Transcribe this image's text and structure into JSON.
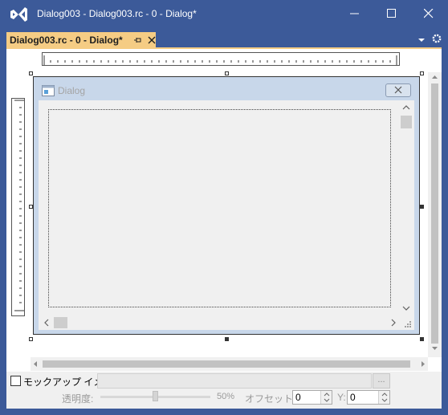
{
  "window": {
    "title": "Dialog003 - Dialog003.rc - 0 - Dialog*",
    "minimize_label": "minimize",
    "maximize_label": "maximize",
    "close_label": "close"
  },
  "tab": {
    "label": "Dialog003.rc - 0 - Dialog*"
  },
  "dialog": {
    "title": "Dialog"
  },
  "bottom": {
    "mockup_label": "モックアップ イメージ",
    "mockup_checked": false,
    "image_path": "",
    "browse_label": "...",
    "opacity_label": "透明度:",
    "opacity_value": 50,
    "opacity_text": "50%",
    "offset_x_label": "オフセット X:",
    "offset_x_value": "0",
    "offset_y_label": "Y:",
    "offset_y_value": "0"
  },
  "colors": {
    "titlebar": "#3c5a99",
    "tab_active": "#f5cc84",
    "dialog_frame": "#c8d7ea",
    "client": "#f0f0f0"
  }
}
